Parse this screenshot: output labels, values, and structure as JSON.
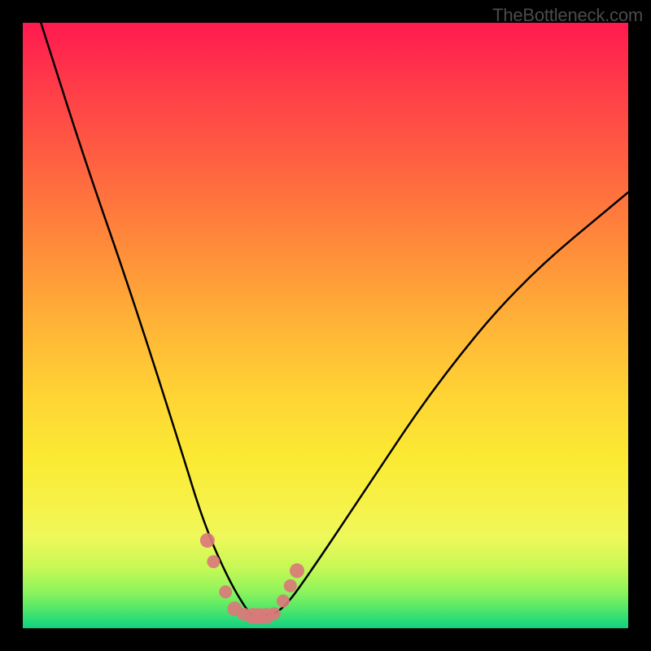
{
  "watermark": "TheBottleneck.com",
  "chart_data": {
    "type": "line",
    "title": "",
    "xlabel": "",
    "ylabel": "",
    "xlim": [
      0,
      100
    ],
    "ylim": [
      0,
      100
    ],
    "background_gradient": [
      "#ff1a4f",
      "#ff6a3f",
      "#ffb437",
      "#fbea33",
      "#8cf45c",
      "#15cf81"
    ],
    "series": [
      {
        "name": "bottleneck-curve",
        "color": "#000000",
        "x": [
          3,
          10,
          18,
          26,
          30,
          34,
          37,
          38,
          40,
          43,
          48,
          56,
          68,
          82,
          100
        ],
        "values": [
          100,
          78,
          55,
          30,
          17,
          8,
          3,
          2,
          2,
          3,
          10,
          22,
          40,
          57,
          72
        ]
      }
    ],
    "markers": {
      "name": "highlight-dots",
      "color": "#d97a7a",
      "x": [
        30.5,
        31.5,
        33.5,
        35.0,
        36.5,
        38.0,
        39.0,
        40.2,
        41.5,
        43.0,
        44.2,
        45.3
      ],
      "values": [
        14.5,
        11.0,
        6.0,
        3.2,
        2.3,
        2.0,
        2.0,
        2.0,
        2.4,
        4.5,
        7.0,
        9.5
      ],
      "sizes": [
        9,
        8,
        8,
        9,
        8,
        10,
        10,
        10,
        8,
        8,
        8,
        9
      ]
    }
  }
}
